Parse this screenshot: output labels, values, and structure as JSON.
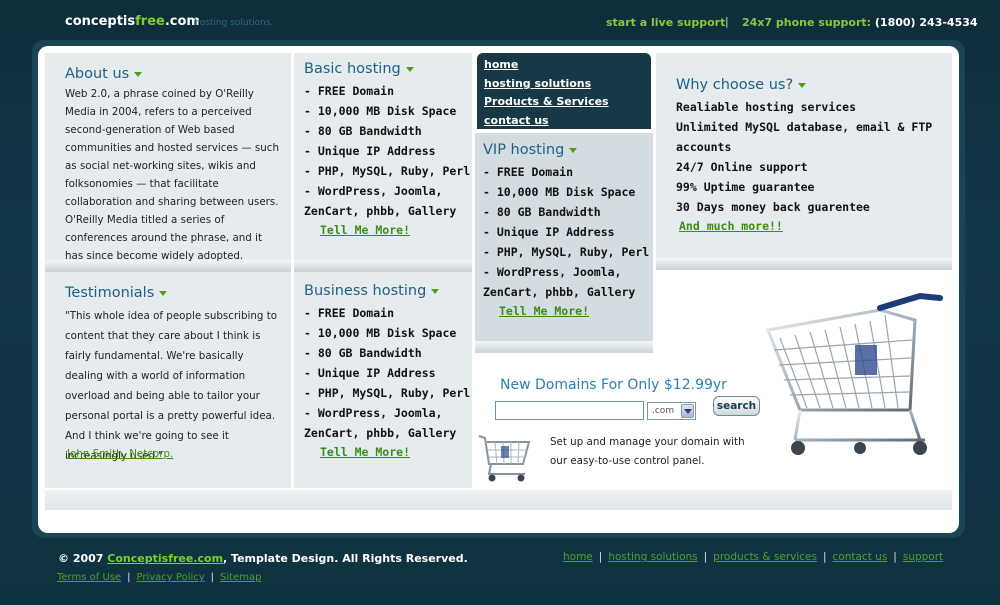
{
  "header": {
    "logo": {
      "part1": "conceptis",
      "part2": "free",
      "part3": ".com"
    },
    "tagline": "hosting solutions.",
    "live_support": "start a live support",
    "separator": "|",
    "phone_label": "24x7 phone support:",
    "phone_number": "(1800) 243-4534"
  },
  "nav": {
    "items": [
      "home",
      "hosting solutions",
      "Products & Services",
      "contact us"
    ]
  },
  "about": {
    "title": "About us",
    "text": "Web 2.0, a phrase coined by O'Reilly Media in 2004, refers to a perceived second-generation of Web based communities and hosted services — such as social net-working sites, wikis and folksonomies — that facilitate collaboration and sharing between users. O'Reilly Media titled a series of conferences around the phrase, and it has since become widely adopted."
  },
  "testimonials": {
    "title": "Testimonials",
    "quote": "\"This whole idea of people subscribing to content that they care about I think is fairly fundamental. We're basically dealing with a world of information overload and being able to tailor your personal portal is a pretty powerful idea. And I think we're going to see it increasingly used.\"",
    "author": "John Smith, Netcorp."
  },
  "plans": {
    "basic": {
      "title": "Basic hosting",
      "features": [
        "- FREE Domain",
        "- 10,000 MB Disk Space",
        "- 80 GB Bandwidth",
        "- Unique IP Address",
        "- PHP, MySQL, Ruby, Perl",
        "- WordPress, Joomla,",
        "ZenCart, phbb, Gallery"
      ],
      "more": "Tell Me More!"
    },
    "business": {
      "title": "Business hosting",
      "features": [
        "- FREE Domain",
        "- 10,000 MB Disk Space",
        "- 80 GB Bandwidth",
        "- Unique IP Address",
        "- PHP, MySQL, Ruby, Perl",
        "- WordPress, Joomla,",
        "ZenCart, phbb, Gallery"
      ],
      "more": "Tell Me More!"
    },
    "vip": {
      "title": "VIP hosting",
      "features": [
        "- FREE Domain",
        "- 10,000 MB Disk Space",
        "- 80 GB Bandwidth",
        "- Unique IP Address",
        "- PHP, MySQL, Ruby, Perl",
        "- WordPress, Joomla,",
        "ZenCart, phbb, Gallery"
      ],
      "more": "Tell Me More!"
    }
  },
  "why": {
    "title": "Why choose us?",
    "items": [
      "Realiable hosting services",
      "Unlimited MySQL database, email & FTP",
      "accounts",
      "24/7 Online support",
      "99% Uptime guarantee",
      "30 Days money back guarentee"
    ],
    "more": "And much more!!"
  },
  "domain": {
    "title": "New Domains For Only $12.99yr",
    "input_value": "",
    "tld_selected": ".com",
    "search_label": "search",
    "description": "Set up and manage your domain with our easy-to-use control panel."
  },
  "footer": {
    "copyright_prefix": "© 2007",
    "copyright_link": "Conceptisfree.com",
    "copyright_suffix": ", Template Design. All Rights Reserved.",
    "left_links": [
      "Terms of Use",
      "Privacy Policy",
      "Sitemap"
    ],
    "right_links": [
      "home",
      "hosting solutions",
      "products & services",
      "contact us",
      "support"
    ]
  }
}
